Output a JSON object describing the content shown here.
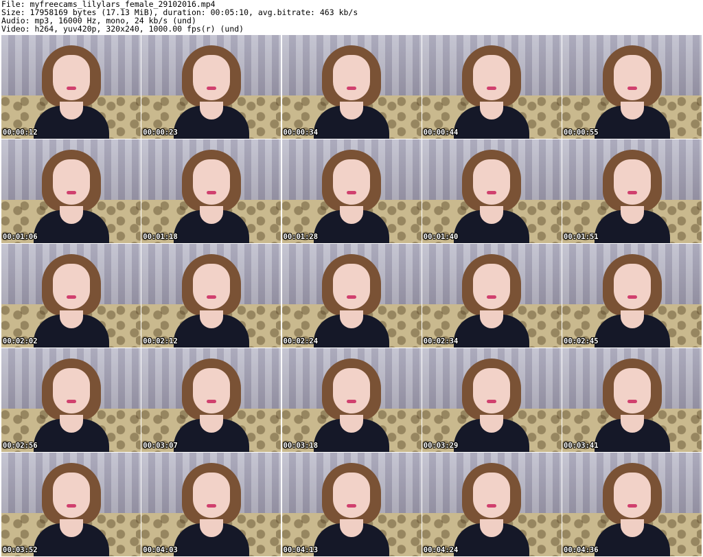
{
  "header": {
    "file_line": "File: myfreecams_lilylars_female_29102016.mp4",
    "size_line": "Size: 17958169 bytes (17.13 MiB), duration: 00:05:10, avg.bitrate: 463 kb/s",
    "audio_line": "Audio: mp3, 16000 Hz, mono, 24 kb/s (und)",
    "video_line": "Video: h264, yuv420p, 320x240, 1000.00 fps(r) (und)"
  },
  "thumbnails": [
    {
      "timestamp": "00:00:12"
    },
    {
      "timestamp": "00:00:23"
    },
    {
      "timestamp": "00:00:34"
    },
    {
      "timestamp": "00:00:44"
    },
    {
      "timestamp": "00:00:55"
    },
    {
      "timestamp": "00:01:06"
    },
    {
      "timestamp": "00:01:18"
    },
    {
      "timestamp": "00:01:28"
    },
    {
      "timestamp": "00:01:40"
    },
    {
      "timestamp": "00:01:51"
    },
    {
      "timestamp": "00:02:02"
    },
    {
      "timestamp": "00:02:12"
    },
    {
      "timestamp": "00:02:24"
    },
    {
      "timestamp": "00:02:34"
    },
    {
      "timestamp": "00:02:45"
    },
    {
      "timestamp": "00:02:56"
    },
    {
      "timestamp": "00:03:07"
    },
    {
      "timestamp": "00:03:18"
    },
    {
      "timestamp": "00:03:29"
    },
    {
      "timestamp": "00:03:41"
    },
    {
      "timestamp": "00:03:52"
    },
    {
      "timestamp": "00:04:03"
    },
    {
      "timestamp": "00:04:13"
    },
    {
      "timestamp": "00:04:24"
    },
    {
      "timestamp": "00:04:36"
    }
  ]
}
